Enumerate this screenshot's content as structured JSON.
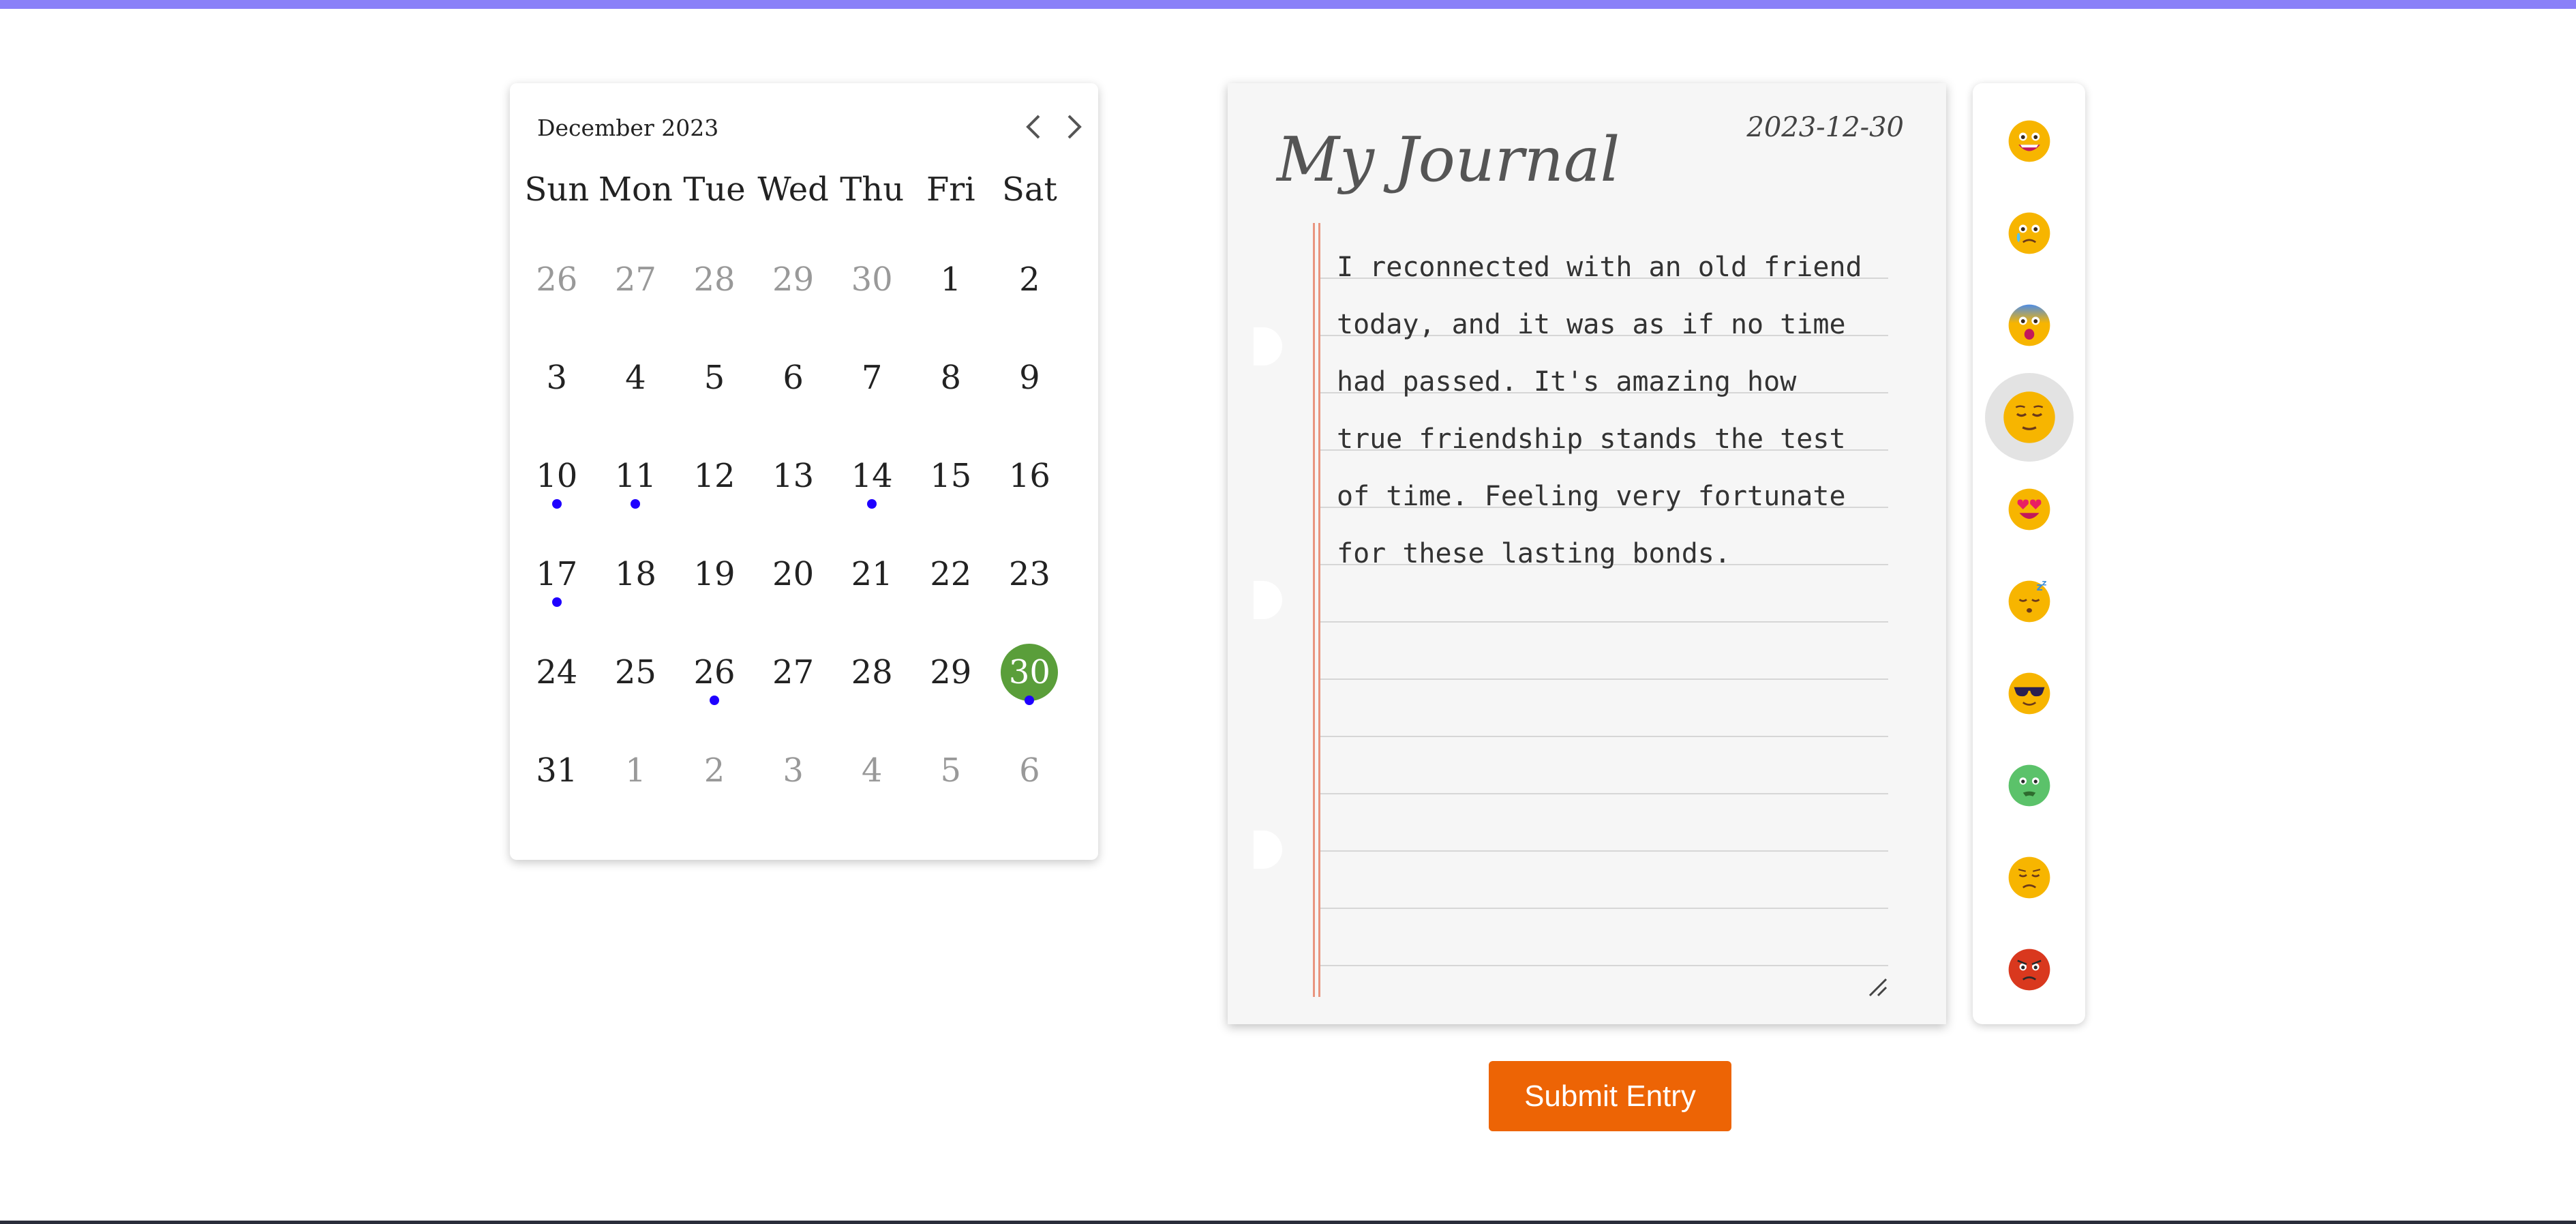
{
  "calendar": {
    "month_label": "December 2023",
    "weekdays": [
      "Sun",
      "Mon",
      "Tue",
      "Wed",
      "Thu",
      "Fri",
      "Sat"
    ],
    "weeks": [
      [
        {
          "d": "26",
          "other": true
        },
        {
          "d": "27",
          "other": true
        },
        {
          "d": "28",
          "other": true
        },
        {
          "d": "29",
          "other": true
        },
        {
          "d": "30",
          "other": true
        },
        {
          "d": "1"
        },
        {
          "d": "2"
        }
      ],
      [
        {
          "d": "3"
        },
        {
          "d": "4"
        },
        {
          "d": "5"
        },
        {
          "d": "6"
        },
        {
          "d": "7"
        },
        {
          "d": "8"
        },
        {
          "d": "9"
        }
      ],
      [
        {
          "d": "10",
          "entry": true
        },
        {
          "d": "11",
          "entry": true
        },
        {
          "d": "12"
        },
        {
          "d": "13"
        },
        {
          "d": "14",
          "entry": true
        },
        {
          "d": "15"
        },
        {
          "d": "16"
        }
      ],
      [
        {
          "d": "17",
          "entry": true
        },
        {
          "d": "18"
        },
        {
          "d": "19"
        },
        {
          "d": "20"
        },
        {
          "d": "21"
        },
        {
          "d": "22"
        },
        {
          "d": "23"
        }
      ],
      [
        {
          "d": "24"
        },
        {
          "d": "25"
        },
        {
          "d": "26",
          "entry": true
        },
        {
          "d": "27"
        },
        {
          "d": "28"
        },
        {
          "d": "29"
        },
        {
          "d": "30",
          "entry": true,
          "selected": true
        }
      ],
      [
        {
          "d": "31"
        },
        {
          "d": "1",
          "other": true
        },
        {
          "d": "2",
          "other": true
        },
        {
          "d": "3",
          "other": true
        },
        {
          "d": "4",
          "other": true
        },
        {
          "d": "5",
          "other": true
        },
        {
          "d": "6",
          "other": true
        }
      ]
    ],
    "selected_color": "#5a9e3a",
    "entry_dot_color": "#1f00ff"
  },
  "journal": {
    "title": "My Journal",
    "date": "2023-12-30",
    "entry_text": "I reconnected with an old friend today, and it was as if no time had passed. It's amazing how true friendship stands the test of time. Feeling very fortunate for these lasting bonds."
  },
  "moods": [
    {
      "icon": "grinning-face-icon"
    },
    {
      "icon": "crying-face-icon"
    },
    {
      "icon": "fearful-face-icon"
    },
    {
      "icon": "relieved-face-icon",
      "selected": true
    },
    {
      "icon": "heart-eyes-face-icon"
    },
    {
      "icon": "sleeping-face-icon"
    },
    {
      "icon": "sunglasses-face-icon"
    },
    {
      "icon": "nauseated-face-icon"
    },
    {
      "icon": "disappointed-face-icon"
    },
    {
      "icon": "angry-face-icon"
    }
  ],
  "submit": {
    "label": "Submit Entry"
  },
  "colors": {
    "accent_top_bar": "#8a80f8",
    "submit_button": "#ed6405"
  }
}
